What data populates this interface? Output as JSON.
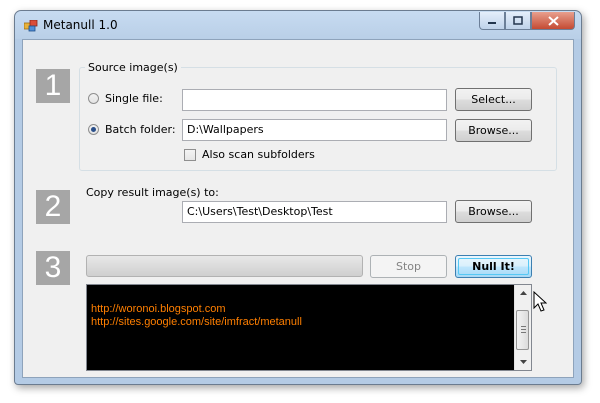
{
  "window": {
    "title": "Metanull 1.0",
    "icon": "app-icon",
    "caption_buttons": {
      "minimize": "minimize-icon",
      "maximize": "maximize-icon",
      "close": "close-icon"
    }
  },
  "steps": [
    "1",
    "2",
    "3"
  ],
  "source": {
    "group_label": "Source image(s)",
    "single_file": {
      "label": "Single file:",
      "value": "",
      "selected": false,
      "button": "Select..."
    },
    "batch_folder": {
      "label": "Batch folder:",
      "value": "D:\\Wallpapers",
      "selected": true,
      "button": "Browse..."
    },
    "scan_subfolders": {
      "label": "Also scan subfolders",
      "checked": false
    }
  },
  "destination": {
    "label": "Copy result image(s) to:",
    "value": "C:\\Users\\Test\\Desktop\\Test",
    "button": "Browse..."
  },
  "process": {
    "progress": 0,
    "stop_button": "Stop",
    "null_button": "Null It!"
  },
  "log": {
    "lines": [
      "http://woronoi.blogspot.com",
      "http://sites.google.com/site/imfract/metanull"
    ],
    "text_color": "#ff7f00"
  },
  "colors": {
    "step_badge": "#a6a6a6",
    "log_bg": "#000000"
  }
}
